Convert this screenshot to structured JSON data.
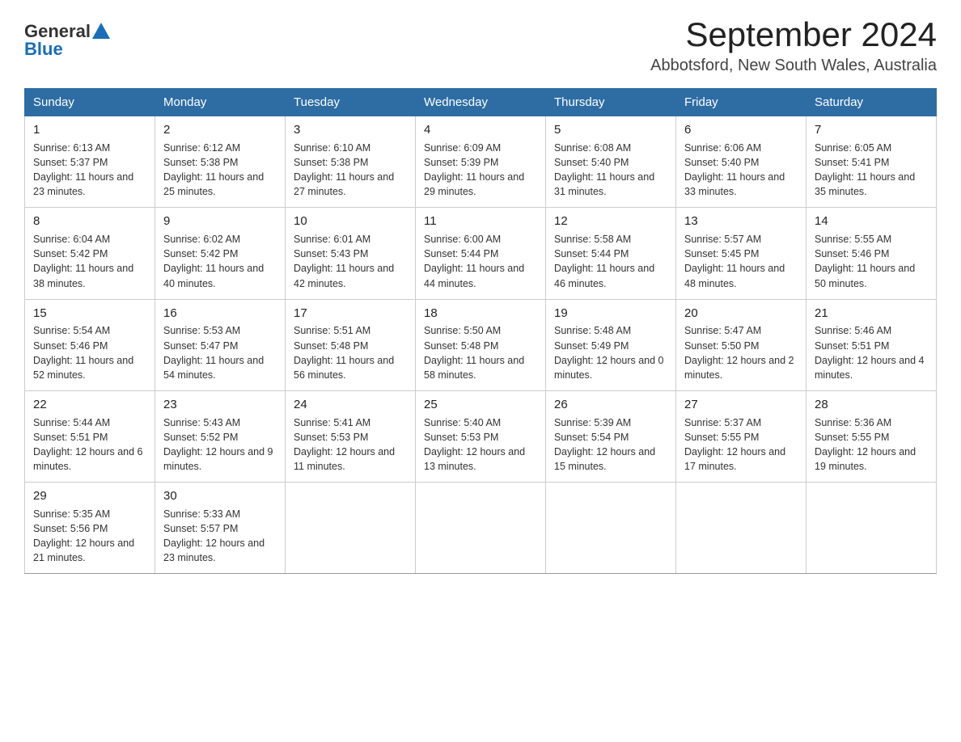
{
  "header": {
    "logo": {
      "general": "General",
      "blue": "Blue"
    },
    "title": "September 2024",
    "subtitle": "Abbotsford, New South Wales, Australia"
  },
  "columns": [
    "Sunday",
    "Monday",
    "Tuesday",
    "Wednesday",
    "Thursday",
    "Friday",
    "Saturday"
  ],
  "weeks": [
    [
      {
        "day": "1",
        "sunrise": "6:13 AM",
        "sunset": "5:37 PM",
        "daylight": "11 hours and 23 minutes."
      },
      {
        "day": "2",
        "sunrise": "6:12 AM",
        "sunset": "5:38 PM",
        "daylight": "11 hours and 25 minutes."
      },
      {
        "day": "3",
        "sunrise": "6:10 AM",
        "sunset": "5:38 PM",
        "daylight": "11 hours and 27 minutes."
      },
      {
        "day": "4",
        "sunrise": "6:09 AM",
        "sunset": "5:39 PM",
        "daylight": "11 hours and 29 minutes."
      },
      {
        "day": "5",
        "sunrise": "6:08 AM",
        "sunset": "5:40 PM",
        "daylight": "11 hours and 31 minutes."
      },
      {
        "day": "6",
        "sunrise": "6:06 AM",
        "sunset": "5:40 PM",
        "daylight": "11 hours and 33 minutes."
      },
      {
        "day": "7",
        "sunrise": "6:05 AM",
        "sunset": "5:41 PM",
        "daylight": "11 hours and 35 minutes."
      }
    ],
    [
      {
        "day": "8",
        "sunrise": "6:04 AM",
        "sunset": "5:42 PM",
        "daylight": "11 hours and 38 minutes."
      },
      {
        "day": "9",
        "sunrise": "6:02 AM",
        "sunset": "5:42 PM",
        "daylight": "11 hours and 40 minutes."
      },
      {
        "day": "10",
        "sunrise": "6:01 AM",
        "sunset": "5:43 PM",
        "daylight": "11 hours and 42 minutes."
      },
      {
        "day": "11",
        "sunrise": "6:00 AM",
        "sunset": "5:44 PM",
        "daylight": "11 hours and 44 minutes."
      },
      {
        "day": "12",
        "sunrise": "5:58 AM",
        "sunset": "5:44 PM",
        "daylight": "11 hours and 46 minutes."
      },
      {
        "day": "13",
        "sunrise": "5:57 AM",
        "sunset": "5:45 PM",
        "daylight": "11 hours and 48 minutes."
      },
      {
        "day": "14",
        "sunrise": "5:55 AM",
        "sunset": "5:46 PM",
        "daylight": "11 hours and 50 minutes."
      }
    ],
    [
      {
        "day": "15",
        "sunrise": "5:54 AM",
        "sunset": "5:46 PM",
        "daylight": "11 hours and 52 minutes."
      },
      {
        "day": "16",
        "sunrise": "5:53 AM",
        "sunset": "5:47 PM",
        "daylight": "11 hours and 54 minutes."
      },
      {
        "day": "17",
        "sunrise": "5:51 AM",
        "sunset": "5:48 PM",
        "daylight": "11 hours and 56 minutes."
      },
      {
        "day": "18",
        "sunrise": "5:50 AM",
        "sunset": "5:48 PM",
        "daylight": "11 hours and 58 minutes."
      },
      {
        "day": "19",
        "sunrise": "5:48 AM",
        "sunset": "5:49 PM",
        "daylight": "12 hours and 0 minutes."
      },
      {
        "day": "20",
        "sunrise": "5:47 AM",
        "sunset": "5:50 PM",
        "daylight": "12 hours and 2 minutes."
      },
      {
        "day": "21",
        "sunrise": "5:46 AM",
        "sunset": "5:51 PM",
        "daylight": "12 hours and 4 minutes."
      }
    ],
    [
      {
        "day": "22",
        "sunrise": "5:44 AM",
        "sunset": "5:51 PM",
        "daylight": "12 hours and 6 minutes."
      },
      {
        "day": "23",
        "sunrise": "5:43 AM",
        "sunset": "5:52 PM",
        "daylight": "12 hours and 9 minutes."
      },
      {
        "day": "24",
        "sunrise": "5:41 AM",
        "sunset": "5:53 PM",
        "daylight": "12 hours and 11 minutes."
      },
      {
        "day": "25",
        "sunrise": "5:40 AM",
        "sunset": "5:53 PM",
        "daylight": "12 hours and 13 minutes."
      },
      {
        "day": "26",
        "sunrise": "5:39 AM",
        "sunset": "5:54 PM",
        "daylight": "12 hours and 15 minutes."
      },
      {
        "day": "27",
        "sunrise": "5:37 AM",
        "sunset": "5:55 PM",
        "daylight": "12 hours and 17 minutes."
      },
      {
        "day": "28",
        "sunrise": "5:36 AM",
        "sunset": "5:55 PM",
        "daylight": "12 hours and 19 minutes."
      }
    ],
    [
      {
        "day": "29",
        "sunrise": "5:35 AM",
        "sunset": "5:56 PM",
        "daylight": "12 hours and 21 minutes."
      },
      {
        "day": "30",
        "sunrise": "5:33 AM",
        "sunset": "5:57 PM",
        "daylight": "12 hours and 23 minutes."
      },
      null,
      null,
      null,
      null,
      null
    ]
  ]
}
